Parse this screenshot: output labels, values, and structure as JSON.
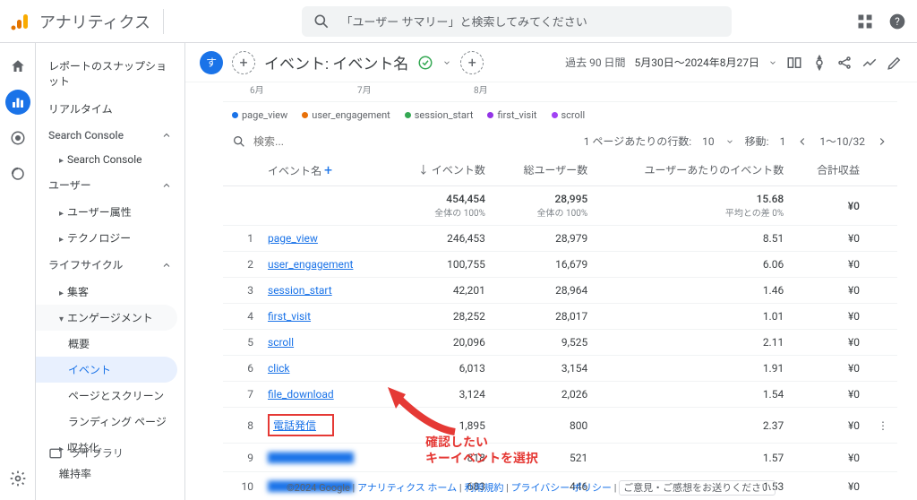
{
  "header": {
    "brand": "アナリティクス",
    "search_placeholder": "「ユーザー サマリー」と検索してみてください"
  },
  "sidebar": {
    "snapshot": "レポートのスナップショット",
    "realtime": "リアルタイム",
    "sections": {
      "search_console": "Search Console",
      "search_console_child": "Search Console",
      "user": "ユーザー",
      "user_attr": "ユーザー属性",
      "tech": "テクノロジー",
      "lifecycle": "ライフサイクル",
      "acquisition": "集客",
      "engagement": "エンゲージメント",
      "overview": "概要",
      "events": "イベント",
      "pages": "ページとスクリーン",
      "landing": "ランディング ページ",
      "monetization": "収益化",
      "retention": "維持率"
    },
    "library": "ライブラリ"
  },
  "toolbar": {
    "badge": "す",
    "title": "イベント: イベント名",
    "date_label": "過去 90 日間",
    "date_range": "5月30日～2024年8月27日"
  },
  "timeline": {
    "m1": "6月",
    "m2": "7月",
    "m3": "8月"
  },
  "legend": [
    {
      "name": "page_view",
      "color": "#1a73e8"
    },
    {
      "name": "user_engagement",
      "color": "#e8710a"
    },
    {
      "name": "session_start",
      "color": "#34a853"
    },
    {
      "name": "first_visit",
      "color": "#9334e6"
    },
    {
      "name": "scroll",
      "color": "#a142f4"
    }
  ],
  "controls": {
    "search": "検索...",
    "rows_label": "1 ページあたりの行数:",
    "rows_value": "10",
    "goto_label": "移動:",
    "goto_value": "1",
    "range": "1～10/32"
  },
  "columns": {
    "event": "イベント名",
    "count": "イベント数",
    "users": "総ユーザー数",
    "per_user": "ユーザーあたりのイベント数",
    "revenue": "合計収益"
  },
  "totals": {
    "count": "454,454",
    "count_sub": "全体の 100%",
    "users": "28,995",
    "users_sub": "全体の 100%",
    "per_user": "15.68",
    "per_user_sub": "平均との差 0%",
    "revenue": "¥0"
  },
  "rows": [
    {
      "idx": "1",
      "name": "page_view",
      "count": "246,453",
      "users": "28,979",
      "per_user": "8.51",
      "revenue": "¥0"
    },
    {
      "idx": "2",
      "name": "user_engagement",
      "count": "100,755",
      "users": "16,679",
      "per_user": "6.06",
      "revenue": "¥0"
    },
    {
      "idx": "3",
      "name": "session_start",
      "count": "42,201",
      "users": "28,964",
      "per_user": "1.46",
      "revenue": "¥0"
    },
    {
      "idx": "4",
      "name": "first_visit",
      "count": "28,252",
      "users": "28,017",
      "per_user": "1.01",
      "revenue": "¥0"
    },
    {
      "idx": "5",
      "name": "scroll",
      "count": "20,096",
      "users": "9,525",
      "per_user": "2.11",
      "revenue": "¥0"
    },
    {
      "idx": "6",
      "name": "click",
      "count": "6,013",
      "users": "3,154",
      "per_user": "1.91",
      "revenue": "¥0"
    },
    {
      "idx": "7",
      "name": "file_download",
      "count": "3,124",
      "users": "2,026",
      "per_user": "1.54",
      "revenue": "¥0"
    },
    {
      "idx": "8",
      "name": "電話発信",
      "count": "1,895",
      "users": "800",
      "per_user": "2.37",
      "revenue": "¥0",
      "highlight": true
    },
    {
      "idx": "9",
      "name": "████████",
      "count": "818",
      "users": "521",
      "per_user": "1.57",
      "revenue": "¥0",
      "blur": true
    },
    {
      "idx": "10",
      "name": "████████",
      "count": "683",
      "users": "446",
      "per_user": "1.53",
      "revenue": "¥0",
      "blur": true
    }
  ],
  "annotation": {
    "l1": "確認したい",
    "l2": "キーイベントを選択"
  },
  "footer": {
    "copyright": "©2024 Google",
    "home": "アナリティクス ホーム",
    "terms": "利用規約",
    "privacy": "プライバシー ポリシー",
    "feedback": "ご意見・ご感想をお送りください"
  }
}
